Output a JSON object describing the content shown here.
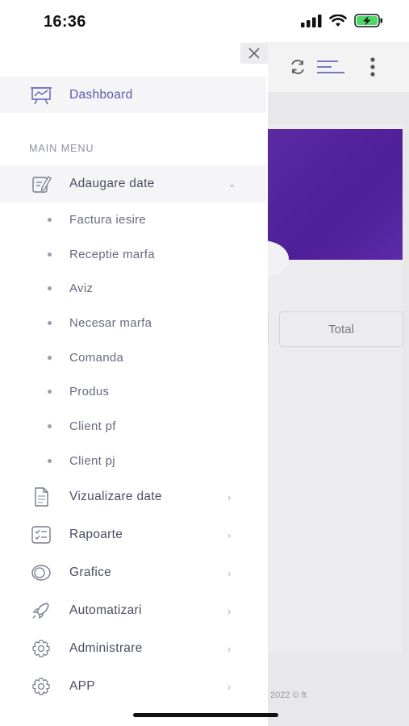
{
  "status_bar": {
    "time": "16:36"
  },
  "drawer": {
    "dashboard_label": "Dashboard",
    "section_title": "MAIN MENU",
    "active_group": {
      "label": "Adaugare date",
      "sub_items": [
        "Factura iesire",
        "Receptie marfa",
        "Aviz",
        "Necesar marfa",
        "Comanda",
        "Produs",
        "Client pf",
        "Client pj"
      ]
    },
    "menu_items": [
      {
        "label": "Vizualizare date",
        "icon": "document-icon"
      },
      {
        "label": "Rapoarte",
        "icon": "report-icon"
      },
      {
        "label": "Grafice",
        "icon": "chart-icon"
      },
      {
        "label": "Automatizari",
        "icon": "rocket-icon"
      },
      {
        "label": "Administrare",
        "icon": "gear-icon"
      },
      {
        "label": "APP",
        "icon": "gear-icon"
      }
    ]
  },
  "background_app": {
    "total_label": "Total",
    "footer_text": "2022 © ft"
  },
  "colors": {
    "accent": "#5c57b0",
    "hero_purple": "#5227a0"
  }
}
